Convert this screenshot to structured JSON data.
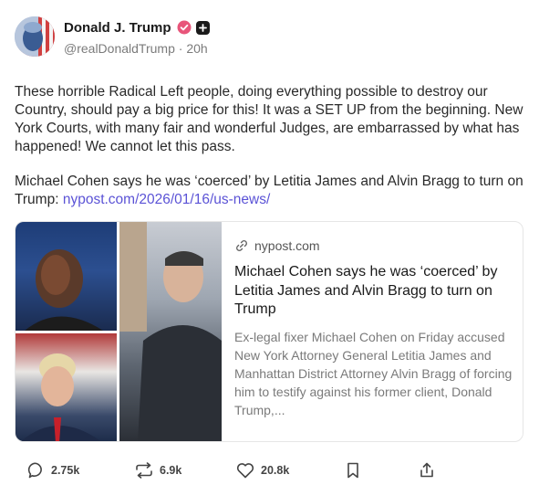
{
  "post": {
    "author": {
      "display_name": "Donald J. Trump",
      "handle": "@realDonaldTrump",
      "separator": " · ",
      "time_ago": "20h"
    },
    "paragraphs": [
      "These horrible Radical Left people, doing everything possible to destroy our Country, should pay a big price for this! It was a SET UP from the beginning. New York Courts, with many fair and wonderful Judges, are embarrassed by what has happened! We cannot let this pass.",
      "Michael Cohen says he was ‘coerced’ by Letitia James and Alvin Bragg to turn on Trump: "
    ],
    "inline_link": "nypost.com/2026/01/16/us-news/",
    "card": {
      "domain": "nypost.com",
      "title": "Michael Cohen says he was ‘coerced’ by Letitia James and Alvin Bragg to turn on Trump",
      "description": "Ex-legal fixer Michael Cohen on Friday accused New York Attorney General Letitia James and Manhattan District Attorney Alvin Bragg of forcing him to testify against his former client, Donald Trump,..."
    },
    "actions": {
      "replies": "2.75k",
      "reposts": "6.9k",
      "likes": "20.8k"
    }
  },
  "icons": {
    "verified": "verified-badge-icon",
    "plus": "plus-badge-icon",
    "link": "link-icon",
    "reply": "reply-icon",
    "repost": "repost-icon",
    "like": "heart-icon",
    "bookmark": "bookmark-icon",
    "share": "share-icon"
  },
  "colors": {
    "verified": "#e8557a",
    "link": "#5b53d6",
    "muted": "#7b7b7b"
  }
}
